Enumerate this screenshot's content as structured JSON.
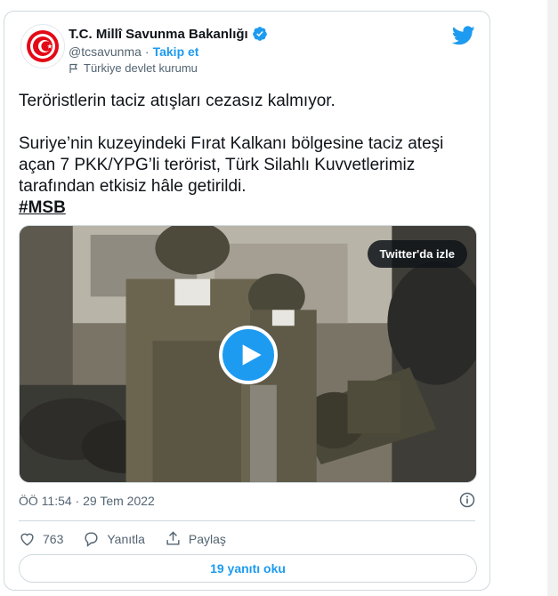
{
  "account": {
    "display_name": "T.C. Millî Savunma Bakanlığı",
    "handle": "@tcsavunma",
    "separator": "·",
    "follow_label": "Takip et",
    "government_label": "Türkiye devlet kurumu"
  },
  "tweet": {
    "line1": "Teröristlerin taciz atışları cezasız kalmıyor.",
    "line2": "Suriye’nin kuzeyindeki Fırat Kalkanı bölgesine taciz ateşi açan 7 PKK/YPG’li terörist, Türk Silahlı Kuvvetlerimiz tarafından etkisiz hâle getirildi.",
    "hashtag": "#MSB"
  },
  "media": {
    "watch_label": "Twitter'da izle"
  },
  "meta": {
    "timestamp": "ÖÖ 11:54 · 29 Tem 2022"
  },
  "actions": {
    "like_count": "763",
    "reply_label": "Yanıtla",
    "share_label": "Paylaş"
  },
  "replies_button": "19 yanıtı oku",
  "colors": {
    "accent": "#1d9bf0",
    "text": "#0f1419",
    "secondary": "#536471",
    "border": "#cfd9de"
  }
}
